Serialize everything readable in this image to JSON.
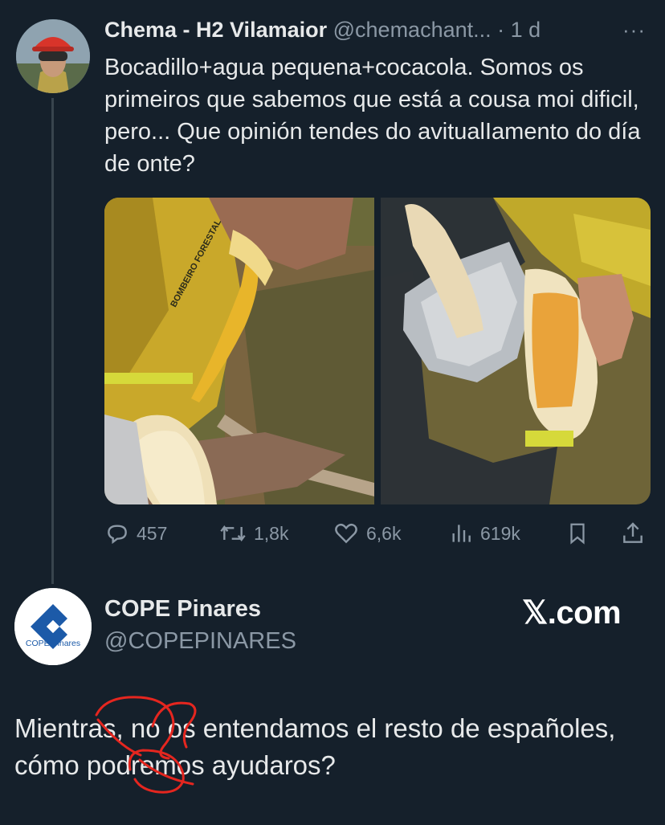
{
  "tweet": {
    "author_name": "Chema - H2 Vilamaior",
    "author_handle": "@chemachant...",
    "time": "· 1 d",
    "more": "···",
    "text": "Bocadillo+agua pequena+cocacola. Somos os primeiros que sabemos que está a cousa moi dificil, pero... Que opinión tendes do avitualIamento do día de onte?",
    "photo1_label": "BOMBEIRO FORESTAL",
    "actions": {
      "replies": "457",
      "retweets": "1,8k",
      "likes": "6,6k",
      "views": "619k"
    }
  },
  "reply": {
    "author_name": "COPE Pinares",
    "author_handle": "@COPEPINARES",
    "avatar_logo_text": "COPE Pinares",
    "watermark": "𝕏.com",
    "text": "Mientras, no os entendamos el resto de españoles, cómo podremos ayudaros?"
  },
  "colors": {
    "background": "#15202b",
    "text": "#e7e9ea",
    "muted": "#8b98a5",
    "cope_blue": "#1c5aa8",
    "annotation_red": "#e5261f"
  }
}
